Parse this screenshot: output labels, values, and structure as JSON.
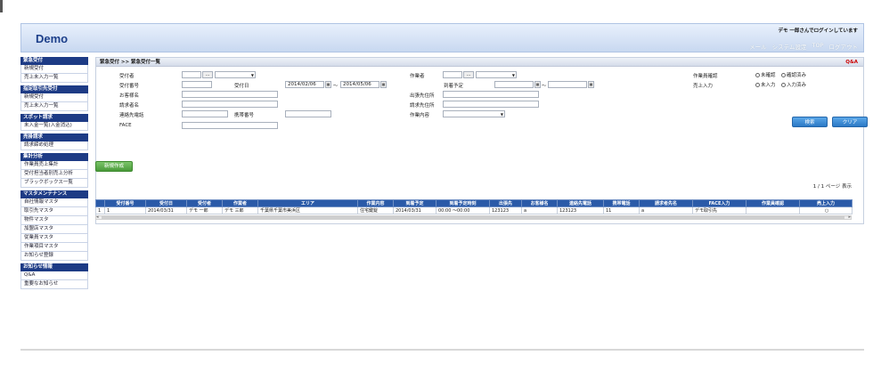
{
  "header": {
    "logo": "Demo",
    "login_message": "デモ 一郎さんでログインしています",
    "nav": [
      "メール",
      "システム設定",
      "TOP",
      "ログアウト"
    ]
  },
  "sidebar": [
    {
      "title": "緊急受付",
      "items": [
        "新規受付",
        "売上未入力一覧"
      ]
    },
    {
      "title": "指定取引先受付",
      "items": [
        "新規受付",
        "売上未入力一覧"
      ]
    },
    {
      "title": "スポット請求",
      "items": [
        "未入金一覧(入金消込)"
      ]
    },
    {
      "title": "売掛請求",
      "items": [
        "請求締め処理"
      ]
    },
    {
      "title": "集計分析",
      "items": [
        "作業員売上集計",
        "受付担当者別売上分析",
        "ブラックボックス一覧"
      ]
    },
    {
      "title": "マスタメンテナンス",
      "items": [
        "自社情報マスタ",
        "取引先マスタ",
        "物件マスタ",
        "加盟店マスタ",
        "従業員マスタ",
        "作業項目マスタ",
        "お知らせ登録"
      ]
    },
    {
      "title": "お知らせ情報",
      "items": [
        "Q&A",
        "重要なお知らせ"
      ]
    }
  ],
  "main": {
    "breadcrumb": "緊急受付 >> 緊急受付一覧",
    "qa_link": "Q&A",
    "form": {
      "receptionist": "受付者",
      "reception_no": "受付番号",
      "reception_date": "受付日",
      "date_from": "2014/02/06",
      "date_sep": "〜",
      "date_to": "2014/05/06",
      "customer_name": "お客様名",
      "billing_name": "請求者名",
      "contact_phone": "連絡先電話",
      "mobile_no": "携帯番号",
      "face": "FACE",
      "worker": "作業者",
      "arrival_schedule": "到着予定",
      "arrival_sep": "〜",
      "dispatch_address": "出張先住所",
      "billing_address": "請求先住所",
      "work_content": "作業内容",
      "work_confirm": "作業員確認",
      "work_confirm_options": [
        "未確認",
        "確認済み"
      ],
      "sales_input": "売上入力",
      "sales_input_options": [
        "未入力",
        "入力済み"
      ],
      "dots": "..."
    },
    "buttons": {
      "search": "検索",
      "clear": "クリア",
      "new": "新規作成"
    },
    "page_info": "1 / 1 ページ 表示"
  },
  "table": {
    "headers": [
      "",
      "受付番号",
      "受付日",
      "受付者",
      "作業者",
      "エリア",
      "作業内容",
      "到着予定",
      "到着予定時刻",
      "出張先",
      "お客様名",
      "連絡先電話",
      "携帯電話",
      "請求者先名",
      "FACE入力",
      "作業員確認",
      "売上入力"
    ],
    "rows": [
      [
        "1",
        "1",
        "2014/03/31",
        "デモ 一郎",
        "デモ 三郎",
        "千葉県千葉市美浜区",
        "住宅鍵錠",
        "2014/03/31",
        "00:00 〜00:00",
        "123123",
        "a",
        "123123",
        "11",
        "a",
        "デモ取引先",
        "",
        "○"
      ]
    ]
  },
  "colors": {
    "sidebar_head": "#1d3b85",
    "table_head": "#2a5aa8",
    "search_btn": "#2b78c5",
    "new_btn": "#4a9a3a",
    "qa": "#cc0000"
  }
}
